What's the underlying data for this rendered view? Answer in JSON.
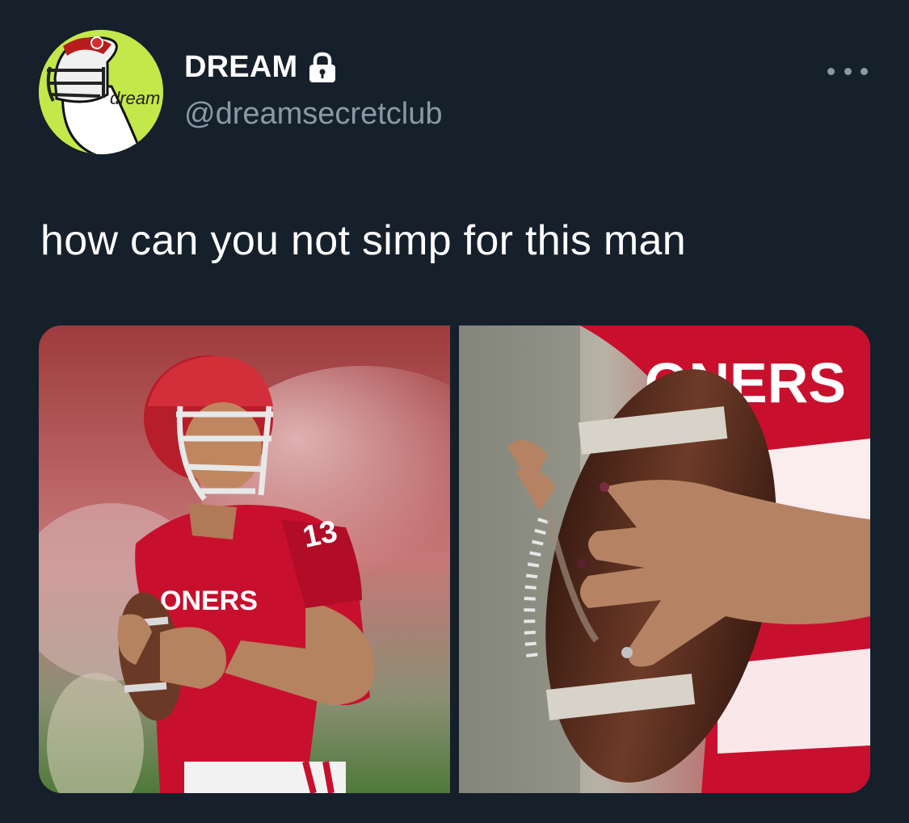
{
  "tweet": {
    "author": {
      "display_name": "DREAM",
      "handle": "@dreamsecretclub",
      "protected": true,
      "avatar_text": "dream"
    },
    "text": "how can you not simp for this man",
    "media": [
      {
        "kind": "photo",
        "jersey_text": "ONERS",
        "jersey_number": "13"
      },
      {
        "kind": "photo",
        "jersey_text": "ONERS"
      }
    ]
  },
  "icons": {
    "lock": "lock-icon",
    "more": "more-icon"
  },
  "colors": {
    "background": "#15202b",
    "text": "#ffffff",
    "secondary": "#8b98a5",
    "avatar_bg": "#c2e84a",
    "crimson": "#c8102e"
  }
}
